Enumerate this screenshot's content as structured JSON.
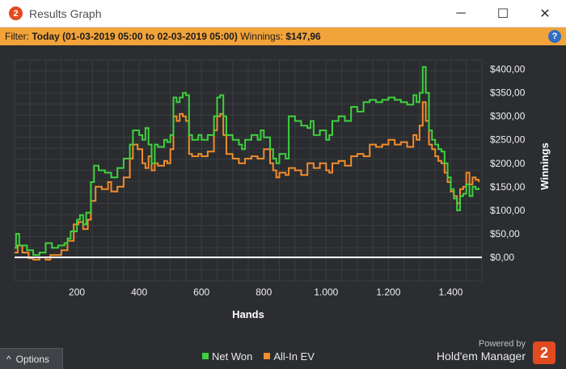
{
  "window": {
    "title": "Results Graph",
    "logo_text": "2",
    "minimize_glyph": "─",
    "maximize_glyph": "☐",
    "close_glyph": "✕"
  },
  "filter": {
    "label": "Filter:",
    "value": "Today (01-03-2019 05:00 to 02-03-2019 05:00)",
    "winnings_label": "Winnings:",
    "winnings_value": "$147,96",
    "help_glyph": "?"
  },
  "options": {
    "label": "Options",
    "icon": "chevron-up-icon",
    "glyph": "^"
  },
  "branding": {
    "powered_by": "Powered by",
    "name": "Hold'em Manager",
    "logo_text": "2",
    "accent": "#e24a20"
  },
  "chart_data": {
    "type": "line",
    "xlabel": "Hands",
    "ylabel": "Winnings",
    "xlim": [
      0,
      1500
    ],
    "ylim": [
      -50,
      420
    ],
    "x_ticks": [
      200,
      400,
      600,
      800,
      1000,
      1200,
      1400
    ],
    "x_tick_labels": [
      "200",
      "400",
      "600",
      "800",
      "1.000",
      "1.200",
      "1.400"
    ],
    "y_ticks": [
      0,
      50,
      100,
      150,
      200,
      250,
      300,
      350,
      400
    ],
    "y_tick_labels": [
      "$0,00",
      "$50,00",
      "$100,00",
      "$150,00",
      "$200,00",
      "$250,00",
      "$300,00",
      "$350,00",
      "$400,00"
    ],
    "grid": true,
    "legend": "bottom-center",
    "zero_line_color": "#ffffff",
    "series": [
      {
        "name": "Net Won",
        "color": "#3fd13f",
        "points": [
          [
            0,
            20
          ],
          [
            5,
            50
          ],
          [
            15,
            25
          ],
          [
            40,
            15
          ],
          [
            60,
            5
          ],
          [
            80,
            10
          ],
          [
            100,
            30
          ],
          [
            120,
            20
          ],
          [
            140,
            25
          ],
          [
            160,
            30
          ],
          [
            170,
            40
          ],
          [
            180,
            55
          ],
          [
            200,
            80
          ],
          [
            210,
            90
          ],
          [
            220,
            70
          ],
          [
            230,
            95
          ],
          [
            245,
            160
          ],
          [
            255,
            195
          ],
          [
            270,
            185
          ],
          [
            290,
            180
          ],
          [
            310,
            170
          ],
          [
            330,
            190
          ],
          [
            350,
            210
          ],
          [
            370,
            240
          ],
          [
            380,
            270
          ],
          [
            400,
            260
          ],
          [
            410,
            250
          ],
          [
            420,
            275
          ],
          [
            430,
            240
          ],
          [
            440,
            200
          ],
          [
            450,
            240
          ],
          [
            460,
            235
          ],
          [
            480,
            250
          ],
          [
            490,
            245
          ],
          [
            500,
            260
          ],
          [
            510,
            340
          ],
          [
            520,
            330
          ],
          [
            530,
            340
          ],
          [
            540,
            350
          ],
          [
            550,
            345
          ],
          [
            560,
            260
          ],
          [
            570,
            250
          ],
          [
            590,
            260
          ],
          [
            600,
            250
          ],
          [
            620,
            260
          ],
          [
            640,
            300
          ],
          [
            650,
            340
          ],
          [
            660,
            345
          ],
          [
            670,
            300
          ],
          [
            680,
            260
          ],
          [
            700,
            250
          ],
          [
            720,
            240
          ],
          [
            730,
            230
          ],
          [
            740,
            250
          ],
          [
            760,
            260
          ],
          [
            780,
            250
          ],
          [
            790,
            270
          ],
          [
            800,
            255
          ],
          [
            820,
            230
          ],
          [
            830,
            210
          ],
          [
            840,
            200
          ],
          [
            850,
            220
          ],
          [
            870,
            210
          ],
          [
            880,
            300
          ],
          [
            900,
            290
          ],
          [
            920,
            280
          ],
          [
            940,
            275
          ],
          [
            950,
            290
          ],
          [
            960,
            260
          ],
          [
            980,
            270
          ],
          [
            1000,
            250
          ],
          [
            1010,
            260
          ],
          [
            1020,
            290
          ],
          [
            1040,
            300
          ],
          [
            1060,
            290
          ],
          [
            1080,
            320
          ],
          [
            1100,
            310
          ],
          [
            1120,
            330
          ],
          [
            1140,
            335
          ],
          [
            1160,
            330
          ],
          [
            1180,
            335
          ],
          [
            1200,
            340
          ],
          [
            1220,
            335
          ],
          [
            1240,
            330
          ],
          [
            1260,
            325
          ],
          [
            1280,
            345
          ],
          [
            1290,
            330
          ],
          [
            1300,
            350
          ],
          [
            1310,
            405
          ],
          [
            1320,
            350
          ],
          [
            1330,
            270
          ],
          [
            1340,
            250
          ],
          [
            1350,
            240
          ],
          [
            1360,
            230
          ],
          [
            1370,
            225
          ],
          [
            1380,
            200
          ],
          [
            1390,
            170
          ],
          [
            1400,
            145
          ],
          [
            1410,
            125
          ],
          [
            1420,
            100
          ],
          [
            1430,
            130
          ],
          [
            1440,
            135
          ],
          [
            1450,
            155
          ],
          [
            1460,
            130
          ],
          [
            1470,
            150
          ],
          [
            1480,
            145
          ],
          [
            1490,
            148
          ]
        ]
      },
      {
        "name": "All-In EV",
        "color": "#f28c2b",
        "points": [
          [
            0,
            10
          ],
          [
            10,
            25
          ],
          [
            25,
            10
          ],
          [
            45,
            -2
          ],
          [
            60,
            -5
          ],
          [
            80,
            0
          ],
          [
            100,
            -5
          ],
          [
            115,
            5
          ],
          [
            130,
            5
          ],
          [
            150,
            15
          ],
          [
            170,
            35
          ],
          [
            190,
            70
          ],
          [
            205,
            75
          ],
          [
            220,
            60
          ],
          [
            235,
            80
          ],
          [
            245,
            120
          ],
          [
            260,
            150
          ],
          [
            280,
            145
          ],
          [
            300,
            160
          ],
          [
            310,
            140
          ],
          [
            330,
            150
          ],
          [
            350,
            170
          ],
          [
            370,
            210
          ],
          [
            380,
            240
          ],
          [
            395,
            230
          ],
          [
            410,
            200
          ],
          [
            420,
            190
          ],
          [
            430,
            215
          ],
          [
            440,
            185
          ],
          [
            450,
            200
          ],
          [
            460,
            195
          ],
          [
            480,
            205
          ],
          [
            490,
            200
          ],
          [
            500,
            230
          ],
          [
            510,
            300
          ],
          [
            520,
            290
          ],
          [
            530,
            305
          ],
          [
            540,
            300
          ],
          [
            550,
            290
          ],
          [
            560,
            220
          ],
          [
            570,
            215
          ],
          [
            590,
            220
          ],
          [
            600,
            215
          ],
          [
            620,
            225
          ],
          [
            640,
            270
          ],
          [
            650,
            300
          ],
          [
            660,
            305
          ],
          [
            670,
            260
          ],
          [
            680,
            220
          ],
          [
            700,
            210
          ],
          [
            720,
            200
          ],
          [
            740,
            210
          ],
          [
            760,
            215
          ],
          [
            780,
            210
          ],
          [
            800,
            230
          ],
          [
            820,
            200
          ],
          [
            830,
            185
          ],
          [
            840,
            170
          ],
          [
            850,
            180
          ],
          [
            870,
            175
          ],
          [
            880,
            190
          ],
          [
            900,
            185
          ],
          [
            920,
            175
          ],
          [
            940,
            200
          ],
          [
            960,
            190
          ],
          [
            980,
            200
          ],
          [
            1000,
            185
          ],
          [
            1010,
            180
          ],
          [
            1020,
            200
          ],
          [
            1040,
            205
          ],
          [
            1060,
            195
          ],
          [
            1080,
            215
          ],
          [
            1100,
            220
          ],
          [
            1120,
            215
          ],
          [
            1140,
            240
          ],
          [
            1160,
            235
          ],
          [
            1180,
            240
          ],
          [
            1200,
            250
          ],
          [
            1220,
            240
          ],
          [
            1240,
            245
          ],
          [
            1260,
            235
          ],
          [
            1280,
            260
          ],
          [
            1290,
            250
          ],
          [
            1300,
            280
          ],
          [
            1310,
            330
          ],
          [
            1320,
            290
          ],
          [
            1330,
            240
          ],
          [
            1340,
            230
          ],
          [
            1350,
            215
          ],
          [
            1360,
            205
          ],
          [
            1370,
            200
          ],
          [
            1380,
            180
          ],
          [
            1390,
            160
          ],
          [
            1400,
            140
          ],
          [
            1410,
            130
          ],
          [
            1420,
            115
          ],
          [
            1430,
            145
          ],
          [
            1440,
            150
          ],
          [
            1450,
            180
          ],
          [
            1460,
            155
          ],
          [
            1470,
            170
          ],
          [
            1480,
            165
          ],
          [
            1490,
            160
          ]
        ]
      }
    ]
  }
}
